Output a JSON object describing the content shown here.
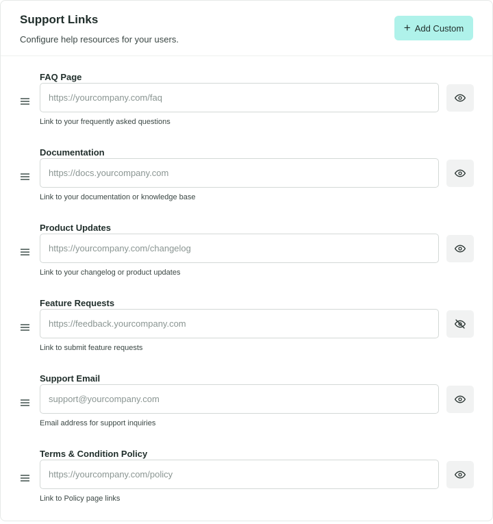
{
  "header": {
    "title": "Support Links",
    "subtitle": "Configure help resources for your users.",
    "add_button_label": "Add Custom",
    "add_button_icon": "plus-icon"
  },
  "colors": {
    "accent": "#aff2ea",
    "icon_button_bg": "#f1f2f2",
    "border": "#d3d8d6"
  },
  "links": [
    {
      "label": "FAQ Page",
      "value": "",
      "placeholder": "https://yourcompany.com/faq",
      "hint": "Link to your frequently asked questions",
      "visible": true
    },
    {
      "label": "Documentation",
      "value": "",
      "placeholder": "https://docs.yourcompany.com",
      "hint": "Link to your documentation or knowledge base",
      "visible": true
    },
    {
      "label": "Product Updates",
      "value": "",
      "placeholder": "https://yourcompany.com/changelog",
      "hint": "Link to your changelog or product updates",
      "visible": true
    },
    {
      "label": "Feature Requests",
      "value": "",
      "placeholder": "https://feedback.yourcompany.com",
      "hint": "Link to submit feature requests",
      "visible": false
    },
    {
      "label": "Support Email",
      "value": "",
      "placeholder": "support@yourcompany.com",
      "hint": "Email address for support inquiries",
      "visible": true
    },
    {
      "label": "Terms & Condition Policy",
      "value": "",
      "placeholder": "https://yourcompany.com/policy",
      "hint": "Link to Policy page links",
      "visible": true
    }
  ]
}
